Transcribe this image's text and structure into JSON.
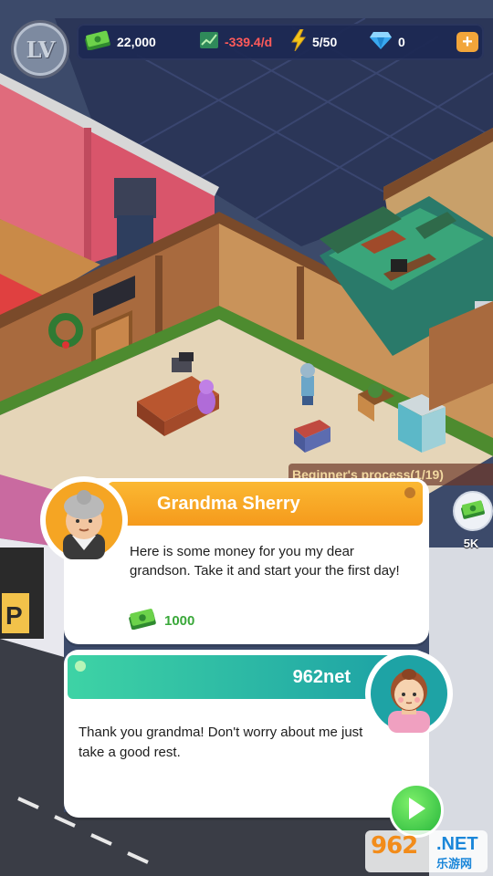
{
  "hud": {
    "level_label": "LV",
    "money": "22,000",
    "rate": "-339.4/d",
    "energy": "5/50",
    "gems": "0",
    "plus": "+"
  },
  "side": {
    "beginner_process": "Beginner's process(1/19)",
    "coin_badge": "5K"
  },
  "dialog_grandma": {
    "speaker": "Grandma Sherry",
    "message": "Here is some money for you my dear grandson. Take it and start your the first day!",
    "reward_amount": "1000"
  },
  "dialog_player": {
    "speaker": "962net",
    "message": "Thank you grandma! Don't worry about me just take a good rest."
  },
  "watermark": {
    "main": "962",
    "net": ".NET",
    "sub": "乐游网"
  },
  "colors": {
    "orange_banner": "#f5a523",
    "teal_banner": "#1ea3a5",
    "money_green": "#3aa83a",
    "rate_red": "#ff5a5a",
    "next_green": "#2fbf3f"
  }
}
